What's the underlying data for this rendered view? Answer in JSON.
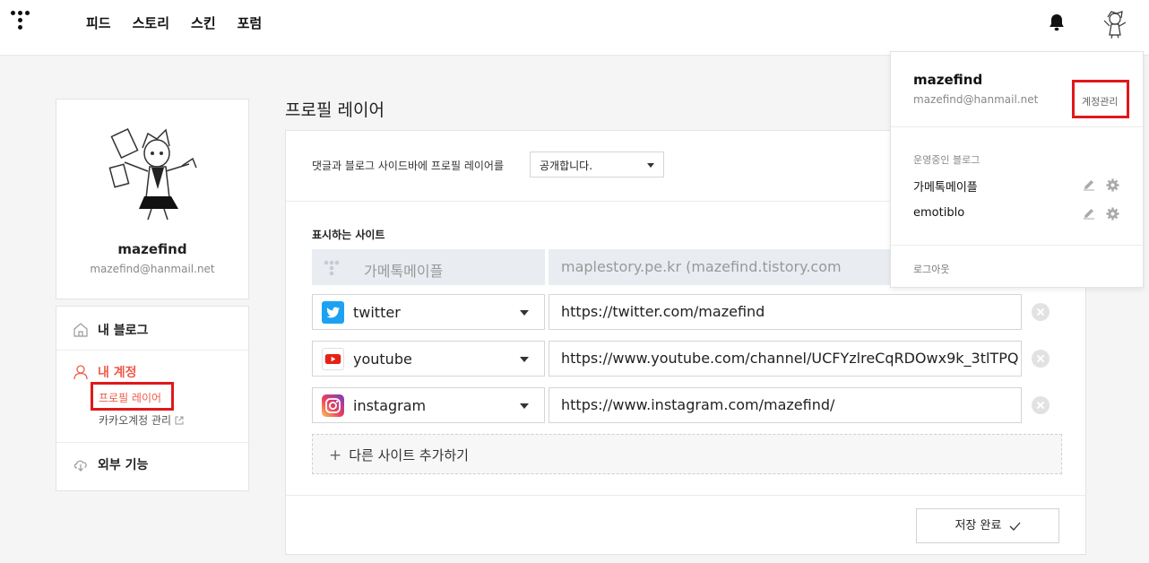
{
  "nav": {
    "items": [
      "피드",
      "스토리",
      "스킨",
      "포럼"
    ]
  },
  "profile": {
    "name": "mazefind",
    "email": "mazefind@hanmail.net"
  },
  "sidebar": {
    "my_blog": "내 블로그",
    "my_account": "내 계정",
    "profile_layer": "프로필 레이어",
    "kakao_account": "카카오계정 관리",
    "external": "외부 기능"
  },
  "main": {
    "title": "프로필 레이어",
    "public_label": "댓글과 블로그 사이드바에 프로필 레이어를",
    "public_value": "공개합니다.",
    "sites_label": "표시하는 사이트",
    "sites": [
      {
        "type": "가메톡메이플",
        "url": "maplestory.pe.kr (mazefind.tistory.com",
        "locked": true,
        "icon": "tistory-icon"
      },
      {
        "type": "twitter",
        "url": "https://twitter.com/mazefind",
        "icon": "twitter-icon"
      },
      {
        "type": "youtube",
        "url": "https://www.youtube.com/channel/UCFYzlreCqRDOwx9k_3tlTPQ",
        "icon": "youtube-icon"
      },
      {
        "type": "instagram",
        "url": "https://www.instagram.com/mazefind/",
        "icon": "instagram-icon"
      }
    ],
    "add_site": "다른 사이트 추가하기",
    "save": "저장 완료"
  },
  "dropdown": {
    "name": "mazefind",
    "email": "mazefind@hanmail.net",
    "account_manage": "계정관리",
    "blogs_label": "운영중인 블로그",
    "blogs": [
      "가메톡메이플",
      "emotiblo"
    ],
    "logout": "로그아웃"
  },
  "colors": {
    "accent": "#f05a4b",
    "highlight_box": "#e0181c",
    "twitter": "#1da1f2",
    "youtube": "#e62117"
  }
}
